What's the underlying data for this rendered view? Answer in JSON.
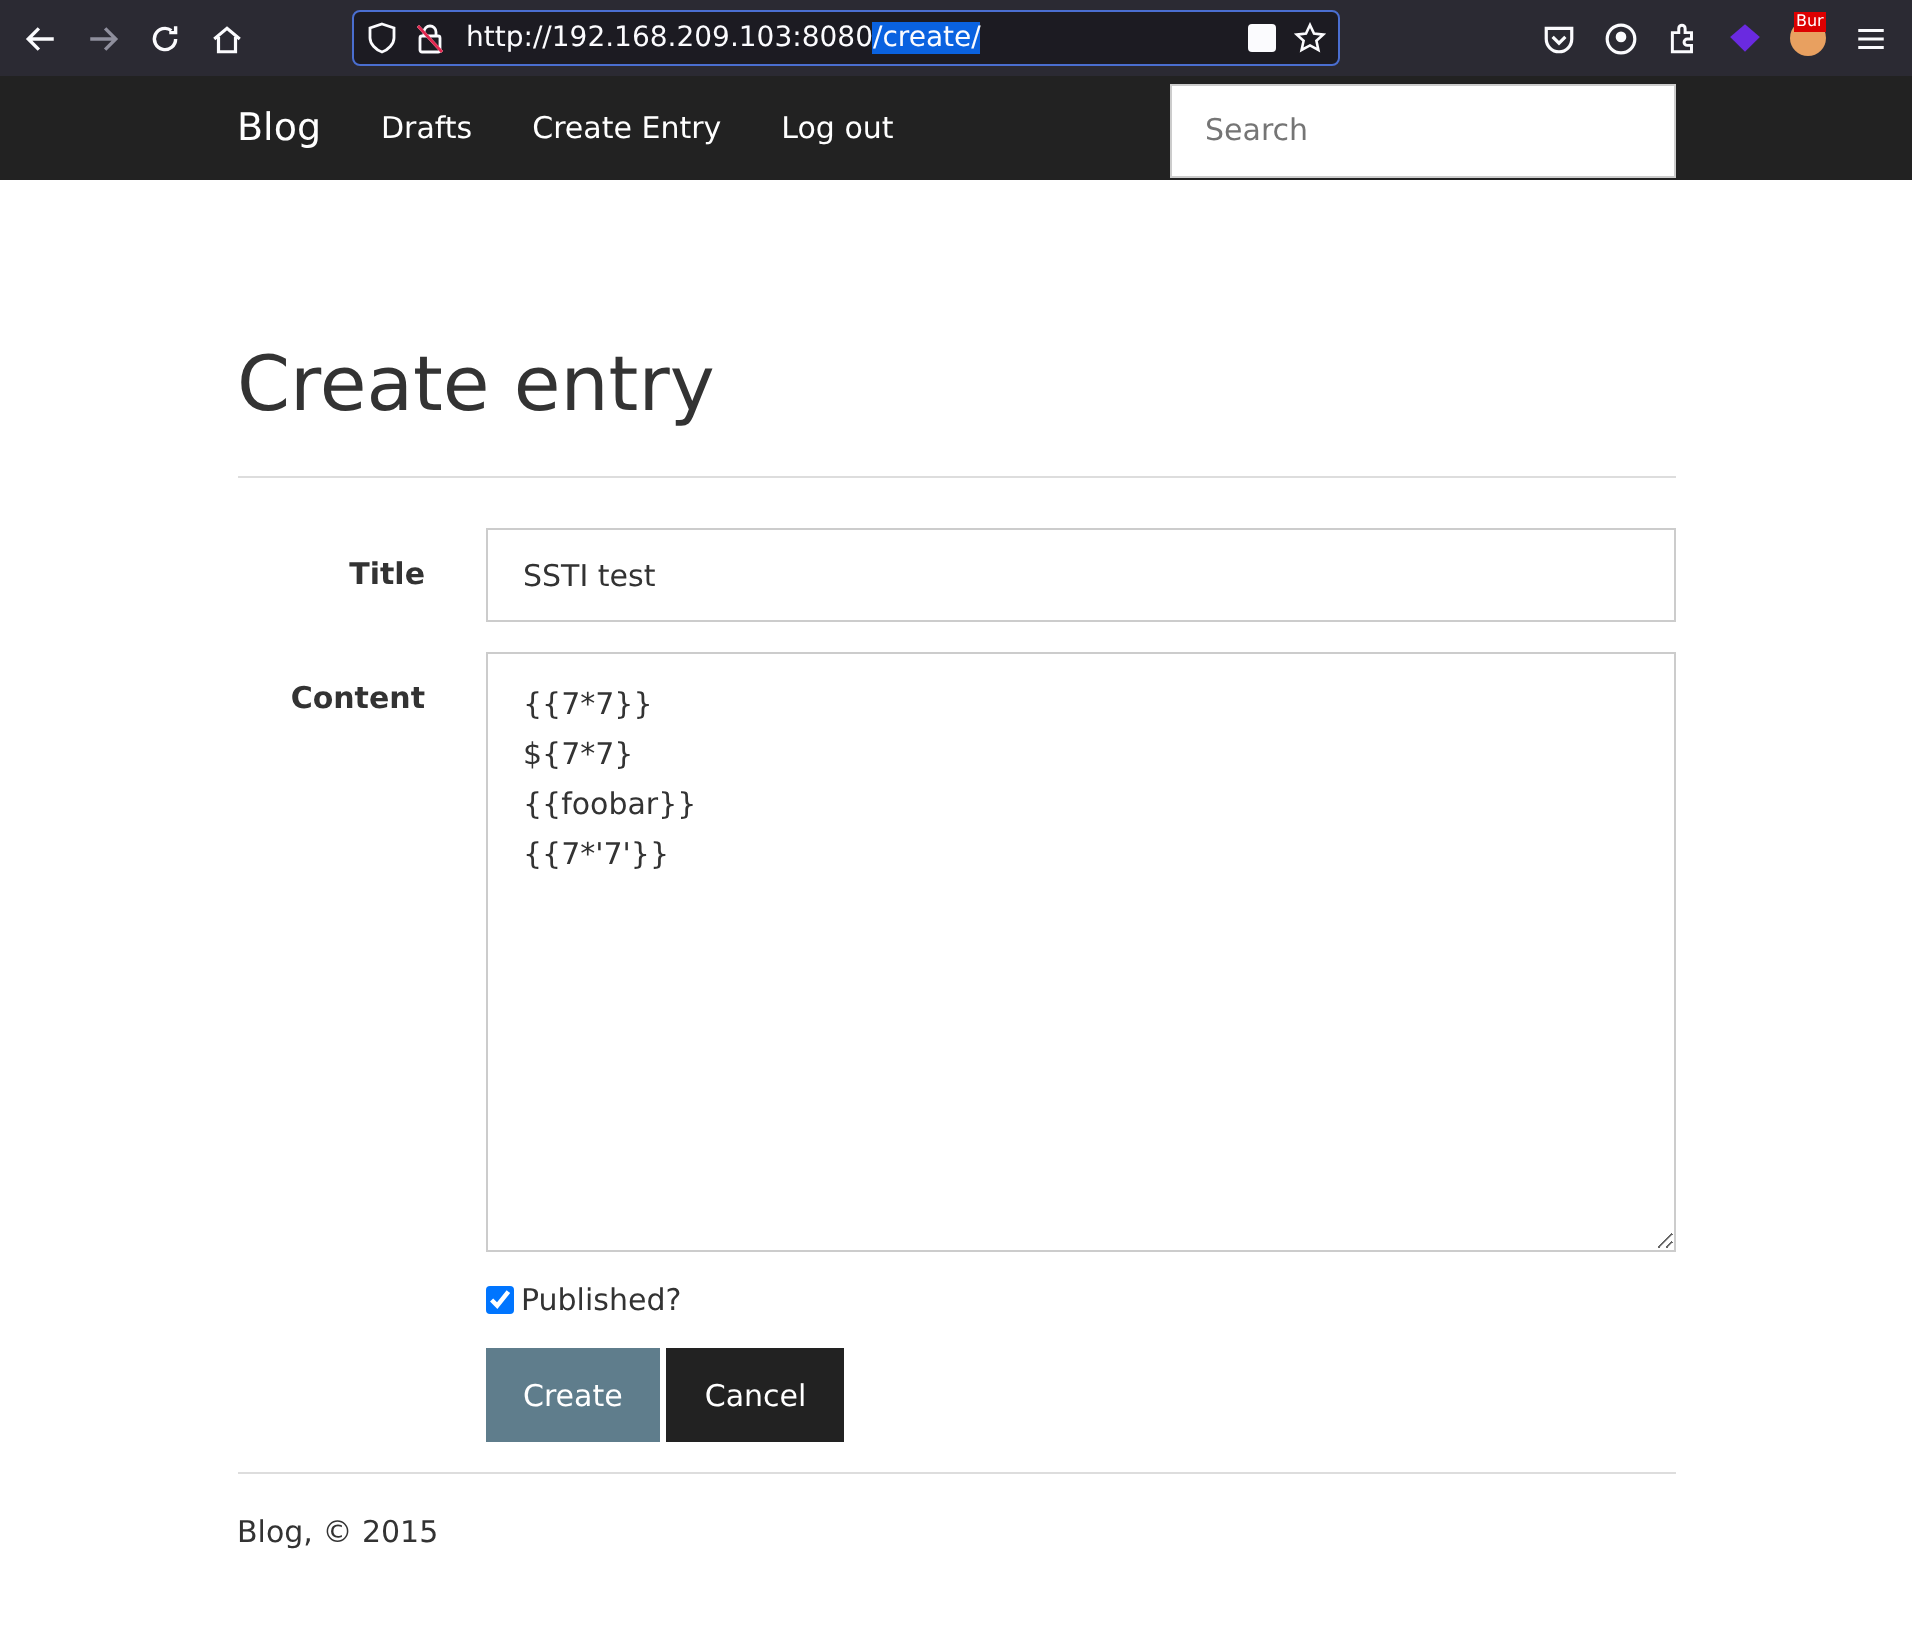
{
  "browser": {
    "url_base": "http://192.168.209.103:8080",
    "url_selected": "/create/",
    "extension_badge": "Bur"
  },
  "navbar": {
    "brand": "Blog",
    "links": [
      {
        "label": "Drafts"
      },
      {
        "label": "Create Entry"
      },
      {
        "label": "Log out"
      }
    ],
    "search": {
      "placeholder": "Search"
    }
  },
  "heading": "Create entry",
  "form": {
    "title_label": "Title",
    "title_value": "SSTI test",
    "content_label": "Content",
    "content_value": "{{7*7}}\n${7*7}\n{{foobar}}\n{{7*'7'}}",
    "published": {
      "label": "Published?",
      "checked": true
    },
    "buttons": [
      {
        "label": "Create",
        "kind": "primary"
      },
      {
        "label": "Cancel",
        "kind": "dark"
      }
    ]
  },
  "footer": "Blog, © 2015"
}
